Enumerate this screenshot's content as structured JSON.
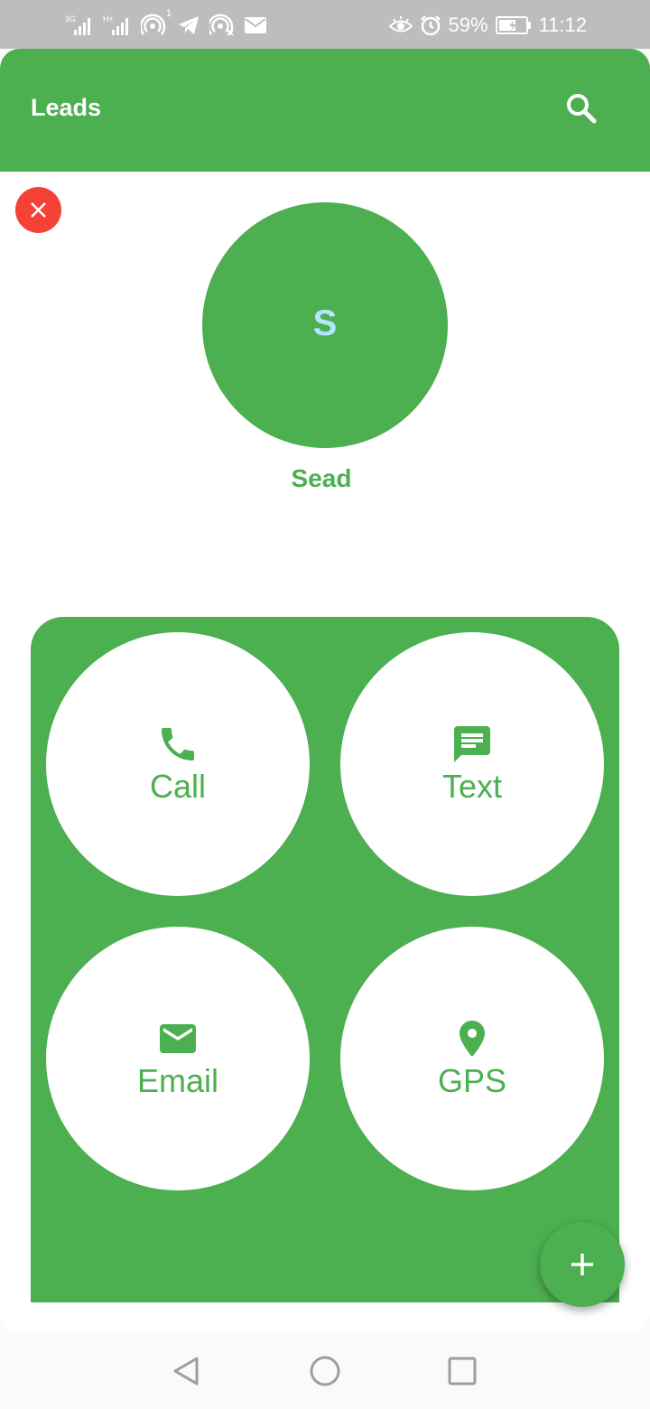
{
  "status_bar": {
    "left_icons": [
      "3g-signal-icon",
      "hplus-signal-icon",
      "hotspot-icon",
      "telegram-icon",
      "hotspot-off-icon",
      "mail-icon"
    ],
    "hotspot_count": "1",
    "battery_percent": "59%",
    "time": "11:12"
  },
  "app_bar": {
    "title": "Leads"
  },
  "lead": {
    "initial": "S",
    "name": "Sead"
  },
  "actions": [
    {
      "label": "Call",
      "icon": "phone-icon"
    },
    {
      "label": "Text",
      "icon": "message-icon"
    },
    {
      "label": "Email",
      "icon": "email-icon"
    },
    {
      "label": "GPS",
      "icon": "location-icon"
    }
  ],
  "colors": {
    "primary": "#4caf50",
    "close": "#f44336",
    "initial": "#b3e5fc",
    "status_bar": "#bdbdbd"
  }
}
